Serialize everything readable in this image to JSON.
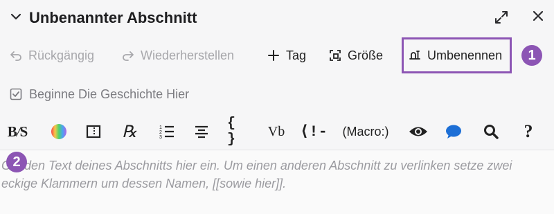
{
  "header": {
    "title": "Unbenannter Abschnitt",
    "collapse_icon": "chevron-down-icon",
    "maximize_icon": "maximize-icon",
    "close_icon": "close-icon"
  },
  "toolbar": {
    "undo_label": "Rückgängig",
    "redo_label": "Wiederherstellen",
    "tag_label": "Tag",
    "size_label": "Größe",
    "rename_label": "Umbenennen"
  },
  "start_checkbox": {
    "label": "Beginne Die Geschichte Hier",
    "checked": true
  },
  "format_toolbar": {
    "macro_label": "(Macro:)",
    "items": [
      "bold-strike-icon",
      "color-icon",
      "border-icon",
      "whitespace-icon",
      "list-icon",
      "align-icon",
      "braces-icon",
      "vb-icon",
      "comment-icon",
      "macro",
      "preview-icon",
      "chat-icon",
      "search-icon",
      "help-icon"
    ]
  },
  "editor": {
    "placeholder": "Gib den Text deines Abschnitts hier ein. Um einen anderen Abschnitt zu verlinken setze zwei eckige Klammern um dessen Namen, [[sowie hier]]."
  },
  "annotations": {
    "badge1": "1",
    "badge2": "2"
  },
  "colors": {
    "accent": "#8c55b4",
    "disabled": "#a7a7ab",
    "chat_blue": "#1d6fd6"
  }
}
